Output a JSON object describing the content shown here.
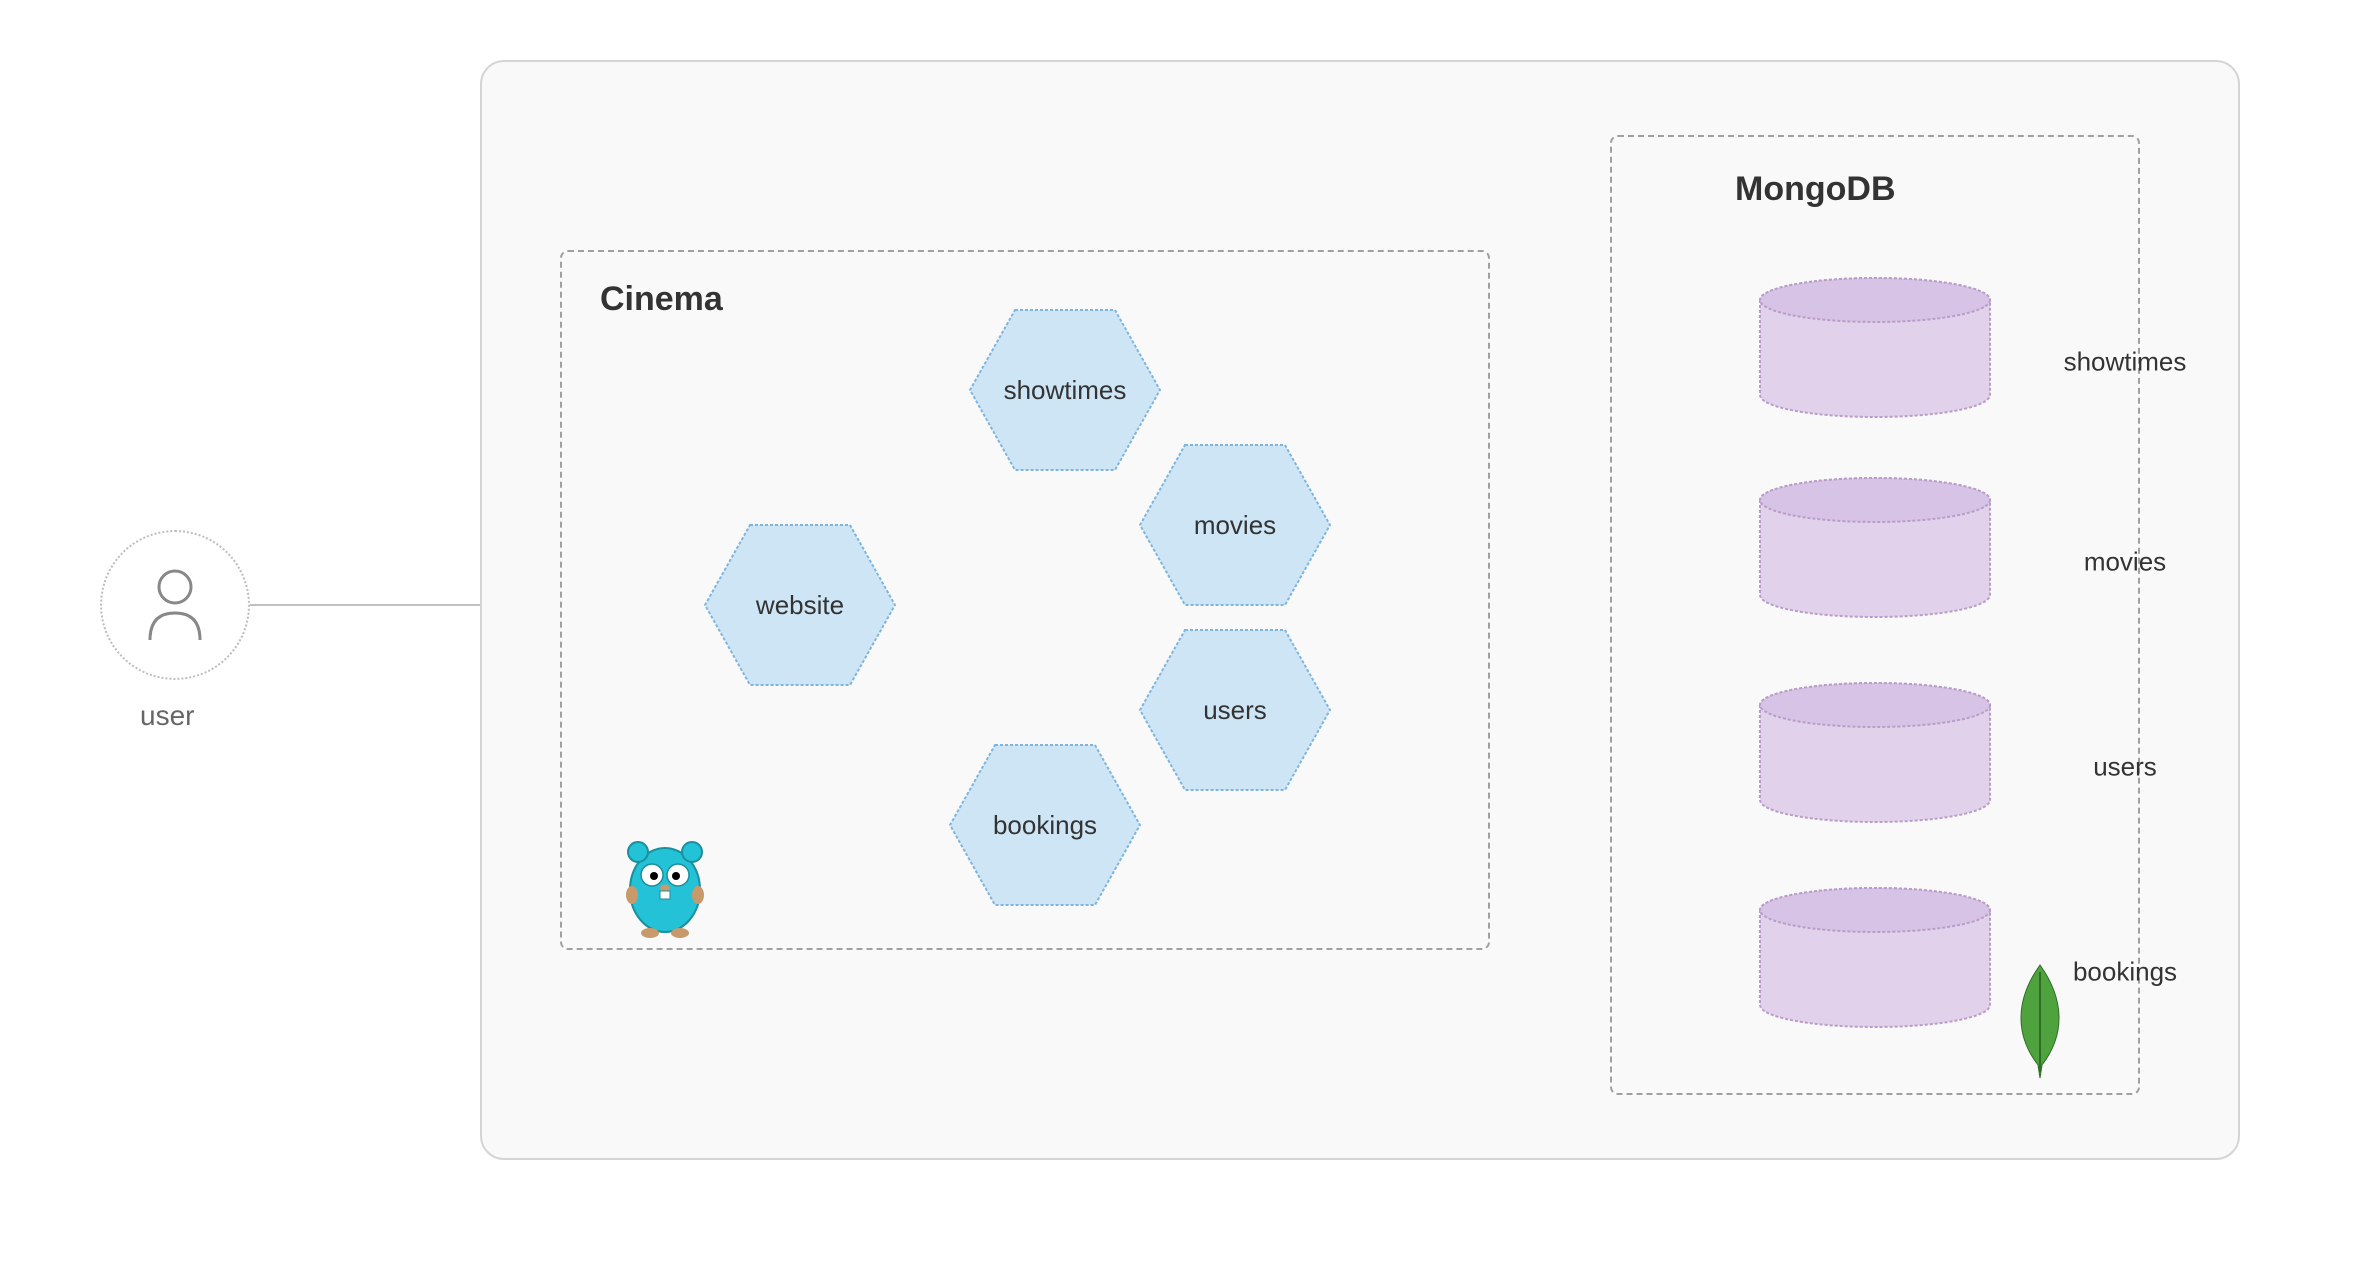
{
  "actors": {
    "user_label": "user"
  },
  "cinema": {
    "title": "Cinema",
    "services": {
      "website": "website",
      "showtimes": "showtimes",
      "movies": "movies",
      "users": "users",
      "bookings": "bookings"
    },
    "tech_icon": "go-gopher"
  },
  "mongodb": {
    "title": "MongoDB",
    "databases": {
      "showtimes": "showtimes",
      "movies": "movies",
      "users": "users",
      "bookings": "bookings"
    },
    "tech_icon": "mongodb-leaf"
  },
  "colors": {
    "hex_fill": "#cee5f6",
    "hex_stroke": "#7eb5e0",
    "cyl_fill": "#e2d1eb",
    "cyl_stroke": "#b89dc9",
    "outer_bg": "#f9f9f9",
    "gopher": "#23c2d6",
    "leaf": "#4fa33f"
  }
}
